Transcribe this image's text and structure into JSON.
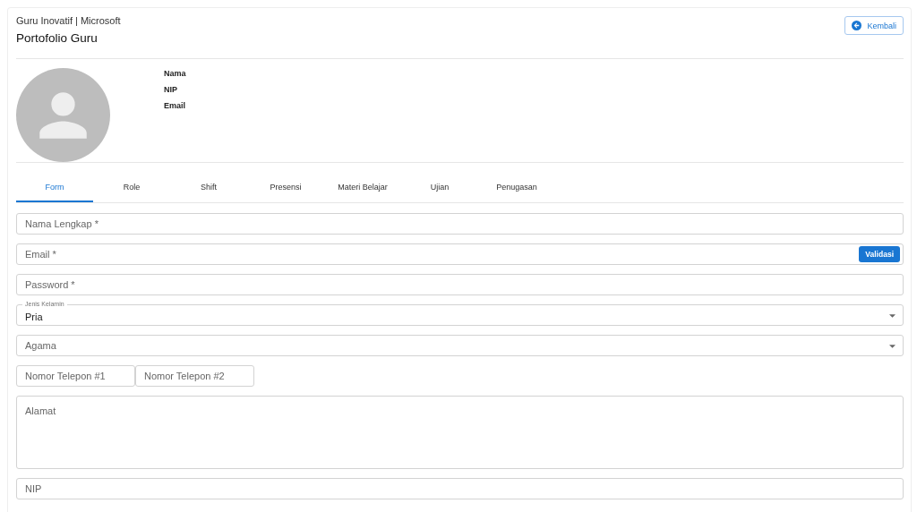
{
  "header": {
    "subtitle": "Guru Inovatif | Microsoft",
    "title": "Portofolio Guru",
    "back_button": "Kembali"
  },
  "profile": {
    "labels": [
      "Nama",
      "NIP",
      "Email"
    ]
  },
  "tabs": [
    {
      "label": "Form",
      "selected": true
    },
    {
      "label": "Role",
      "selected": false
    },
    {
      "label": "Shift",
      "selected": false
    },
    {
      "label": "Presensi",
      "selected": false
    },
    {
      "label": "Materi Belajar",
      "selected": false
    },
    {
      "label": "Ujian",
      "selected": false
    },
    {
      "label": "Penugasan",
      "selected": false
    }
  ],
  "fields": [
    {
      "kind": "text",
      "placeholder": "Nama Lengkap *"
    },
    {
      "kind": "text",
      "placeholder": "Email *",
      "button": "Validasi"
    },
    {
      "kind": "text",
      "placeholder": "Password *"
    },
    {
      "kind": "select",
      "label": "Jenis Kelamin",
      "value": "Pria"
    },
    {
      "kind": "select",
      "placeholder": "Agama"
    },
    {
      "kind": "pair",
      "items": [
        {
          "placeholder": "Nomor Telepon #1"
        },
        {
          "placeholder": "Nomor Telepon #2"
        }
      ]
    },
    {
      "kind": "textarea",
      "placeholder": "Alamat"
    },
    {
      "kind": "text",
      "placeholder": "NIP"
    }
  ]
}
